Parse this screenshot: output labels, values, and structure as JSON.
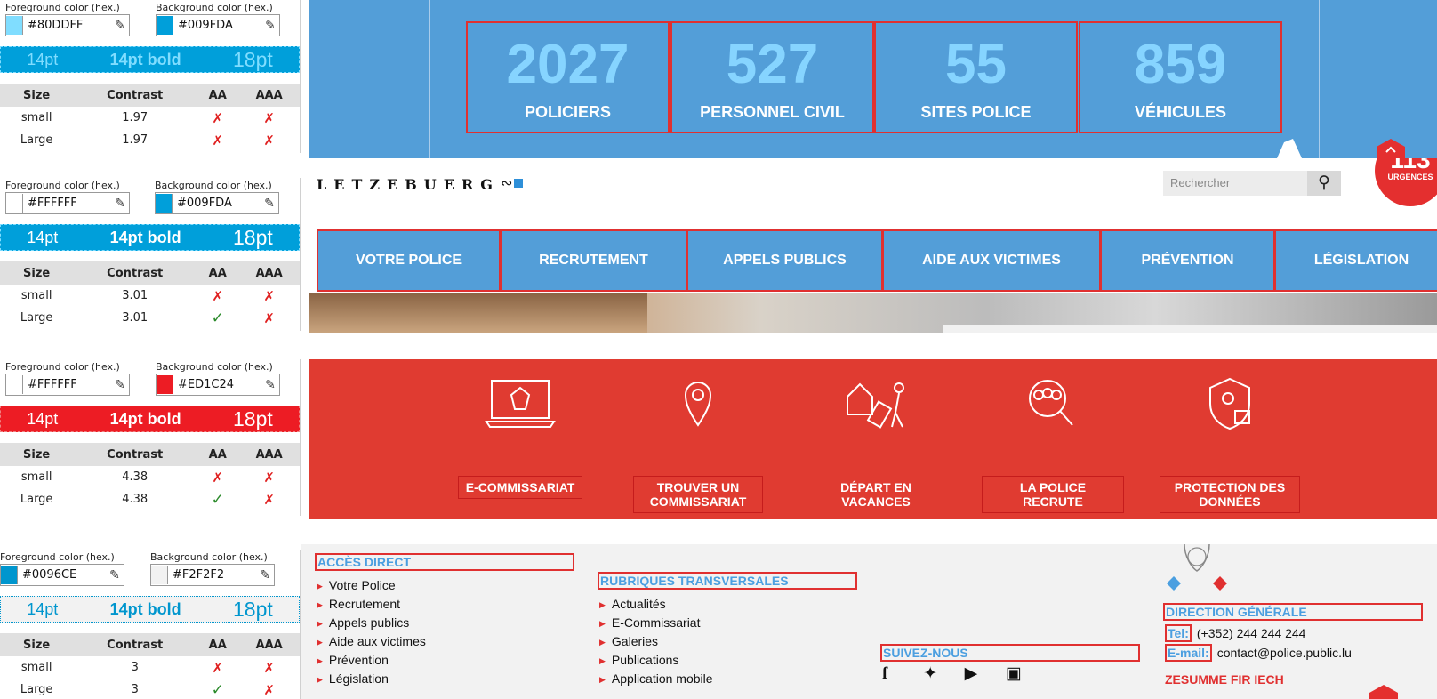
{
  "checker_labels": {
    "fg_label": "Foreground color (hex.)",
    "bg_label": "Background color (hex.)",
    "sample_14": "14pt",
    "sample_14b": "14pt bold",
    "sample_18": "18pt",
    "col_size": "Size",
    "col_contrast": "Contrast",
    "col_aa": "AA",
    "col_aaa": "AAA",
    "row_small": "small",
    "row_large": "Large"
  },
  "checks": [
    {
      "fg": "#80DDFF",
      "bg": "#009FDA",
      "contrast_small": "1.97",
      "contrast_large": "1.97",
      "aa_small": "fail",
      "aaa_small": "fail",
      "aa_large": "fail",
      "aaa_large": "fail"
    },
    {
      "fg": "#FFFFFF",
      "bg": "#009FDA",
      "contrast_small": "3.01",
      "contrast_large": "3.01",
      "aa_small": "fail",
      "aaa_small": "fail",
      "aa_large": "pass",
      "aaa_large": "fail"
    },
    {
      "fg": "#FFFFFF",
      "bg": "#ED1C24",
      "contrast_small": "4.38",
      "contrast_large": "4.38",
      "aa_small": "fail",
      "aaa_small": "fail",
      "aa_large": "pass",
      "aaa_large": "fail"
    },
    {
      "fg": "#0096CE",
      "bg": "#F2F2F2",
      "contrast_small": "3",
      "contrast_large": "3",
      "aa_small": "fail",
      "aaa_small": "fail",
      "aa_large": "pass",
      "aaa_large": "fail"
    }
  ],
  "stats": [
    {
      "number": "2027",
      "label": "POLICIERS"
    },
    {
      "number": "527",
      "label": "PERSONNEL CIVIL"
    },
    {
      "number": "55",
      "label": "SITES POLICE"
    },
    {
      "number": "859",
      "label": "VÉHICULES"
    }
  ],
  "header": {
    "logo_text": "LETZEBUERG",
    "search_placeholder": "Rechercher",
    "emergency_number": "113",
    "emergency_label": "URGENCES"
  },
  "nav": [
    "VOTRE POLICE",
    "RECRUTEMENT",
    "APPELS PUBLICS",
    "AIDE AUX VICTIMES",
    "PRÉVENTION",
    "LÉGISLATION"
  ],
  "services": [
    {
      "label": "E-COMMISSARIAT",
      "icon": "laptop-crest-icon"
    },
    {
      "label": "TROUVER UN COMMISSARIAT",
      "icon": "location-pin-icon"
    },
    {
      "label": "DÉPART EN VACANCES",
      "icon": "house-suitcase-icon"
    },
    {
      "label": "LA POLICE RECRUTE",
      "icon": "magnify-people-icon"
    },
    {
      "label": "PROTECTION DES DONNÉES",
      "icon": "shield-lock-icon"
    }
  ],
  "footer": {
    "direct_title": "ACCÈS DIRECT",
    "direct_links": [
      "Votre Police",
      "Recrutement",
      "Appels publics",
      "Aide aux victimes",
      "Prévention",
      "Législation"
    ],
    "rubriques_title": "RUBRIQUES TRANSVERSALES",
    "rubriques_links": [
      "Actualités",
      "E-Commissariat",
      "Galeries",
      "Publications",
      "Application mobile"
    ],
    "follow_title": "SUIVEZ-NOUS",
    "direction_title": "DIRECTION GÉNÉRALE",
    "tel_label": "Tel:",
    "tel_value": "(+352) 244 244 244",
    "email_label": "E-mail:",
    "email_value": "contact@police.public.lu",
    "zesumme": "ZESUMME FIR IECH"
  },
  "colors": {
    "stats_bg": "#539ed8",
    "stat_number": "#86d4ff",
    "nav_bg": "#539ed8",
    "services_bg": "#e03b31",
    "footer_bg": "#f2f2f2",
    "footer_heading": "#4b9fe0",
    "outline_red": "#e03030"
  }
}
